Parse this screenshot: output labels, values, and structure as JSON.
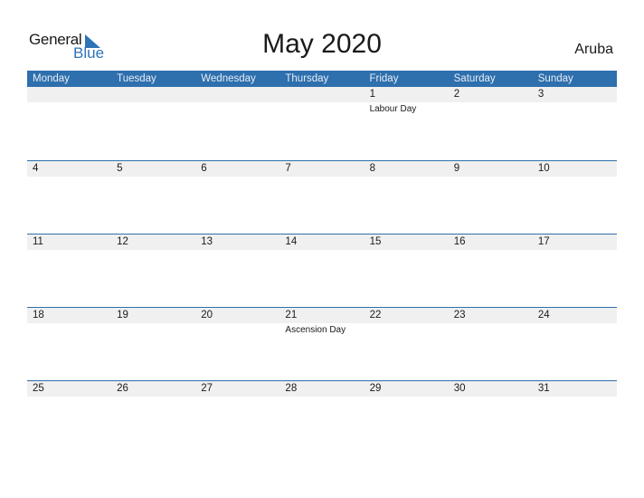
{
  "logo": {
    "line1": "General",
    "line2": "Blue",
    "icon": "triangle-flag-icon"
  },
  "title": "May 2020",
  "country": "Aruba",
  "colors": {
    "accent": "#2e6fad",
    "strip": "#f0f0f0"
  },
  "weekdays": [
    "Monday",
    "Tuesday",
    "Wednesday",
    "Thursday",
    "Friday",
    "Saturday",
    "Sunday"
  ],
  "weeks": [
    {
      "days": [
        {
          "date": "",
          "event": ""
        },
        {
          "date": "",
          "event": ""
        },
        {
          "date": "",
          "event": ""
        },
        {
          "date": "",
          "event": ""
        },
        {
          "date": "1",
          "event": "Labour Day"
        },
        {
          "date": "2",
          "event": ""
        },
        {
          "date": "3",
          "event": ""
        }
      ]
    },
    {
      "days": [
        {
          "date": "4",
          "event": ""
        },
        {
          "date": "5",
          "event": ""
        },
        {
          "date": "6",
          "event": ""
        },
        {
          "date": "7",
          "event": ""
        },
        {
          "date": "8",
          "event": ""
        },
        {
          "date": "9",
          "event": ""
        },
        {
          "date": "10",
          "event": ""
        }
      ]
    },
    {
      "days": [
        {
          "date": "11",
          "event": ""
        },
        {
          "date": "12",
          "event": ""
        },
        {
          "date": "13",
          "event": ""
        },
        {
          "date": "14",
          "event": ""
        },
        {
          "date": "15",
          "event": ""
        },
        {
          "date": "16",
          "event": ""
        },
        {
          "date": "17",
          "event": ""
        }
      ]
    },
    {
      "days": [
        {
          "date": "18",
          "event": ""
        },
        {
          "date": "19",
          "event": ""
        },
        {
          "date": "20",
          "event": ""
        },
        {
          "date": "21",
          "event": "Ascension Day"
        },
        {
          "date": "22",
          "event": ""
        },
        {
          "date": "23",
          "event": ""
        },
        {
          "date": "24",
          "event": ""
        }
      ]
    },
    {
      "days": [
        {
          "date": "25",
          "event": ""
        },
        {
          "date": "26",
          "event": ""
        },
        {
          "date": "27",
          "event": ""
        },
        {
          "date": "28",
          "event": ""
        },
        {
          "date": "29",
          "event": ""
        },
        {
          "date": "30",
          "event": ""
        },
        {
          "date": "31",
          "event": ""
        }
      ]
    }
  ]
}
